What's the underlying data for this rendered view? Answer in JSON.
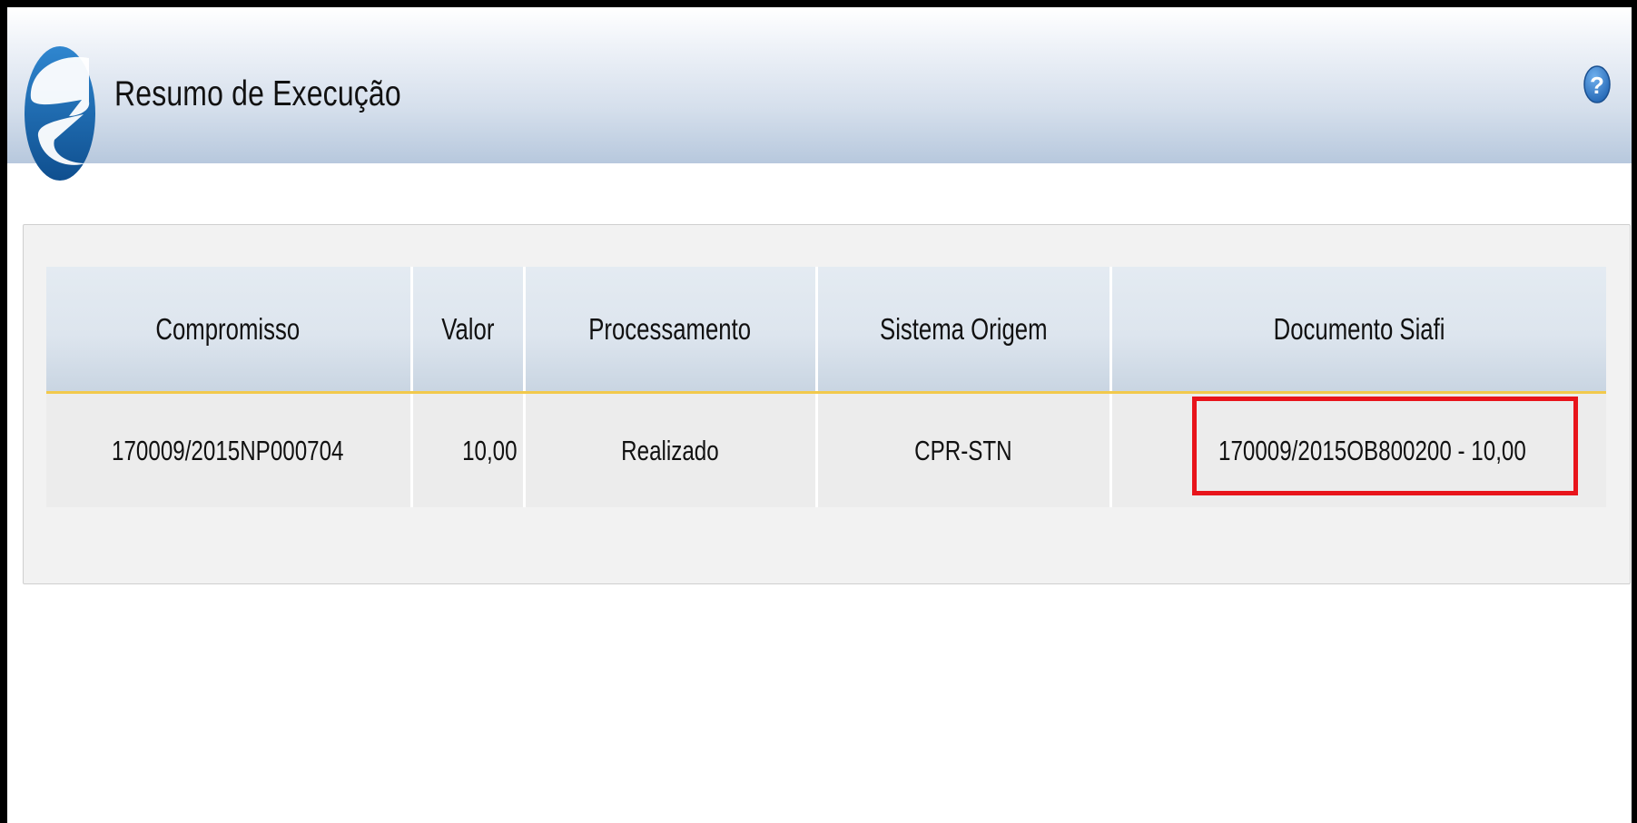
{
  "header": {
    "title": "Resumo de Execução",
    "help_glyph": "?",
    "logo_icon": "siafi-logo-icon",
    "help_icon": "help-icon"
  },
  "table": {
    "columns": [
      "Compromisso",
      "Valor",
      "Processamento",
      "Sistema Origem",
      "Documento Siafi"
    ],
    "rows": [
      {
        "compromisso": "170009/2015NP000704",
        "valor": "10,00",
        "processamento": "Realizado",
        "sistema_origem": "CPR-STN",
        "documento_siafi": "170009/2015OB800200 - 10,00"
      }
    ]
  },
  "colors": {
    "header_gradient_bottom": "#b7c8dd",
    "table_header_bg": "#dde5ee",
    "header_separator": "#f2c94c",
    "row_bg": "#ececec",
    "highlight_box": "#e8141b",
    "logo_blue": "#1b6fb8"
  }
}
